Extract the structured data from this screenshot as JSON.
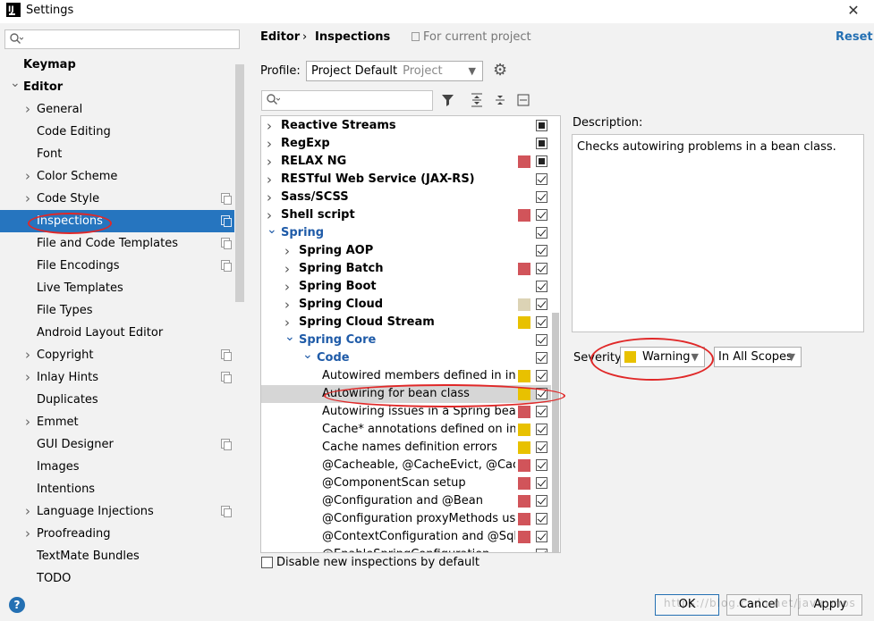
{
  "window": {
    "title": "Settings",
    "close_symbol": "✕"
  },
  "sidebar": {
    "search_placeholder": "",
    "items": [
      {
        "label": "Keymap",
        "level": 0,
        "bold": true,
        "expanded": null,
        "copy": false,
        "selected": false
      },
      {
        "label": "Editor",
        "level": 0,
        "bold": true,
        "expanded": true,
        "copy": false,
        "selected": false
      },
      {
        "label": "General",
        "level": 1,
        "bold": false,
        "expanded": false,
        "copy": false,
        "selected": false
      },
      {
        "label": "Code Editing",
        "level": 1,
        "bold": false,
        "expanded": null,
        "copy": false,
        "selected": false
      },
      {
        "label": "Font",
        "level": 1,
        "bold": false,
        "expanded": null,
        "copy": false,
        "selected": false
      },
      {
        "label": "Color Scheme",
        "level": 1,
        "bold": false,
        "expanded": false,
        "copy": false,
        "selected": false
      },
      {
        "label": "Code Style",
        "level": 1,
        "bold": false,
        "expanded": false,
        "copy": true,
        "selected": false
      },
      {
        "label": "Inspections",
        "level": 1,
        "bold": false,
        "expanded": null,
        "copy": true,
        "selected": true
      },
      {
        "label": "File and Code Templates",
        "level": 1,
        "bold": false,
        "expanded": null,
        "copy": true,
        "selected": false
      },
      {
        "label": "File Encodings",
        "level": 1,
        "bold": false,
        "expanded": null,
        "copy": true,
        "selected": false
      },
      {
        "label": "Live Templates",
        "level": 1,
        "bold": false,
        "expanded": null,
        "copy": false,
        "selected": false
      },
      {
        "label": "File Types",
        "level": 1,
        "bold": false,
        "expanded": null,
        "copy": false,
        "selected": false
      },
      {
        "label": "Android Layout Editor",
        "level": 1,
        "bold": false,
        "expanded": null,
        "copy": false,
        "selected": false
      },
      {
        "label": "Copyright",
        "level": 1,
        "bold": false,
        "expanded": false,
        "copy": true,
        "selected": false
      },
      {
        "label": "Inlay Hints",
        "level": 1,
        "bold": false,
        "expanded": false,
        "copy": true,
        "selected": false
      },
      {
        "label": "Duplicates",
        "level": 1,
        "bold": false,
        "expanded": null,
        "copy": false,
        "selected": false
      },
      {
        "label": "Emmet",
        "level": 1,
        "bold": false,
        "expanded": false,
        "copy": false,
        "selected": false
      },
      {
        "label": "GUI Designer",
        "level": 1,
        "bold": false,
        "expanded": null,
        "copy": true,
        "selected": false
      },
      {
        "label": "Images",
        "level": 1,
        "bold": false,
        "expanded": null,
        "copy": false,
        "selected": false
      },
      {
        "label": "Intentions",
        "level": 1,
        "bold": false,
        "expanded": null,
        "copy": false,
        "selected": false
      },
      {
        "label": "Language Injections",
        "level": 1,
        "bold": false,
        "expanded": false,
        "copy": true,
        "selected": false
      },
      {
        "label": "Proofreading",
        "level": 1,
        "bold": false,
        "expanded": false,
        "copy": false,
        "selected": false
      },
      {
        "label": "TextMate Bundles",
        "level": 1,
        "bold": false,
        "expanded": null,
        "copy": false,
        "selected": false
      },
      {
        "label": "TODO",
        "level": 1,
        "bold": false,
        "expanded": null,
        "copy": false,
        "selected": false
      }
    ]
  },
  "header": {
    "breadcrumb": [
      "Editor",
      "Inspections"
    ],
    "breadcrumb_separator": "›",
    "note": "For current project",
    "reset_label": "Reset"
  },
  "profile": {
    "label": "Profile:",
    "value": "Project Default",
    "sub": "Project"
  },
  "severity_colors": {
    "error": "#d1545a",
    "warning": "#e8c100",
    "weak": "#dcd3b5"
  },
  "tree": {
    "rows": [
      {
        "label": "Reactive Streams",
        "level": 0,
        "kind": "group",
        "expanded": false,
        "sev": null,
        "check": "partial"
      },
      {
        "label": "RegExp",
        "level": 0,
        "kind": "group",
        "expanded": false,
        "sev": null,
        "check": "partial"
      },
      {
        "label": "RELAX NG",
        "level": 0,
        "kind": "group",
        "expanded": false,
        "sev": "error",
        "check": "partial"
      },
      {
        "label": "RESTful Web Service (JAX-RS)",
        "level": 0,
        "kind": "group",
        "expanded": false,
        "sev": null,
        "check": "checked"
      },
      {
        "label": "Sass/SCSS",
        "level": 0,
        "kind": "group",
        "expanded": false,
        "sev": null,
        "check": "checked"
      },
      {
        "label": "Shell script",
        "level": 0,
        "kind": "group",
        "expanded": false,
        "sev": "error",
        "check": "checked"
      },
      {
        "label": "Spring",
        "level": 0,
        "kind": "group-blue",
        "expanded": true,
        "sev": null,
        "check": "checked"
      },
      {
        "label": "Spring AOP",
        "level": 1,
        "kind": "group",
        "expanded": false,
        "sev": null,
        "check": "checked"
      },
      {
        "label": "Spring Batch",
        "level": 1,
        "kind": "group",
        "expanded": false,
        "sev": "error",
        "check": "checked"
      },
      {
        "label": "Spring Boot",
        "level": 1,
        "kind": "group",
        "expanded": false,
        "sev": null,
        "check": "checked"
      },
      {
        "label": "Spring Cloud",
        "level": 1,
        "kind": "group",
        "expanded": false,
        "sev": "weak",
        "check": "checked"
      },
      {
        "label": "Spring Cloud Stream",
        "level": 1,
        "kind": "group",
        "expanded": false,
        "sev": "warning",
        "check": "checked"
      },
      {
        "label": "Spring Core",
        "level": 1,
        "kind": "group-blue",
        "expanded": true,
        "sev": null,
        "check": "checked"
      },
      {
        "label": "Code",
        "level": 2,
        "kind": "group-blue",
        "expanded": true,
        "sev": null,
        "check": "checked"
      },
      {
        "label": "Autowired members defined in inv",
        "level": 3,
        "kind": "item",
        "expanded": null,
        "sev": "warning",
        "check": "checked"
      },
      {
        "label": "Autowiring for bean class",
        "level": 3,
        "kind": "item",
        "expanded": null,
        "sev": "warning",
        "check": "checked",
        "selected": true
      },
      {
        "label": "Autowiring issues in a Spring bean",
        "level": 3,
        "kind": "item",
        "expanded": null,
        "sev": "error",
        "check": "checked"
      },
      {
        "label": "Cache* annotations defined on inte",
        "level": 3,
        "kind": "item",
        "expanded": null,
        "sev": "warning",
        "check": "checked"
      },
      {
        "label": "Cache names definition errors",
        "level": 3,
        "kind": "item",
        "expanded": null,
        "sev": "warning",
        "check": "checked"
      },
      {
        "label": "@Cacheable, @CacheEvict, @Cach",
        "level": 3,
        "kind": "item",
        "expanded": null,
        "sev": "error",
        "check": "checked"
      },
      {
        "label": "@ComponentScan setup",
        "level": 3,
        "kind": "item",
        "expanded": null,
        "sev": "error",
        "check": "checked"
      },
      {
        "label": "@Configuration and @Bean",
        "level": 3,
        "kind": "item",
        "expanded": null,
        "sev": "error",
        "check": "checked"
      },
      {
        "label": "@Configuration proxyMethods usa",
        "level": 3,
        "kind": "item",
        "expanded": null,
        "sev": "error",
        "check": "checked"
      },
      {
        "label": "@ContextConfiguration and @SqlC",
        "level": 3,
        "kind": "item",
        "expanded": null,
        "sev": "error",
        "check": "checked"
      },
      {
        "label": "@EnableSpringConfiguration",
        "level": 3,
        "kind": "item",
        "expanded": null,
        "sev": null,
        "check": "checked"
      }
    ]
  },
  "description": {
    "label": "Description:",
    "text": "Checks autowiring problems in a bean class."
  },
  "severity": {
    "label": "Severity:",
    "value": "Warning",
    "scope": "In All Scopes"
  },
  "disable_new": {
    "label": "Disable new inspections by default",
    "checked": false
  },
  "footer": {
    "help": "?",
    "ok": "OK",
    "cancel": "Cancel",
    "apply": "Apply",
    "watermark": "https://blog.csdn.net/java_mos"
  }
}
